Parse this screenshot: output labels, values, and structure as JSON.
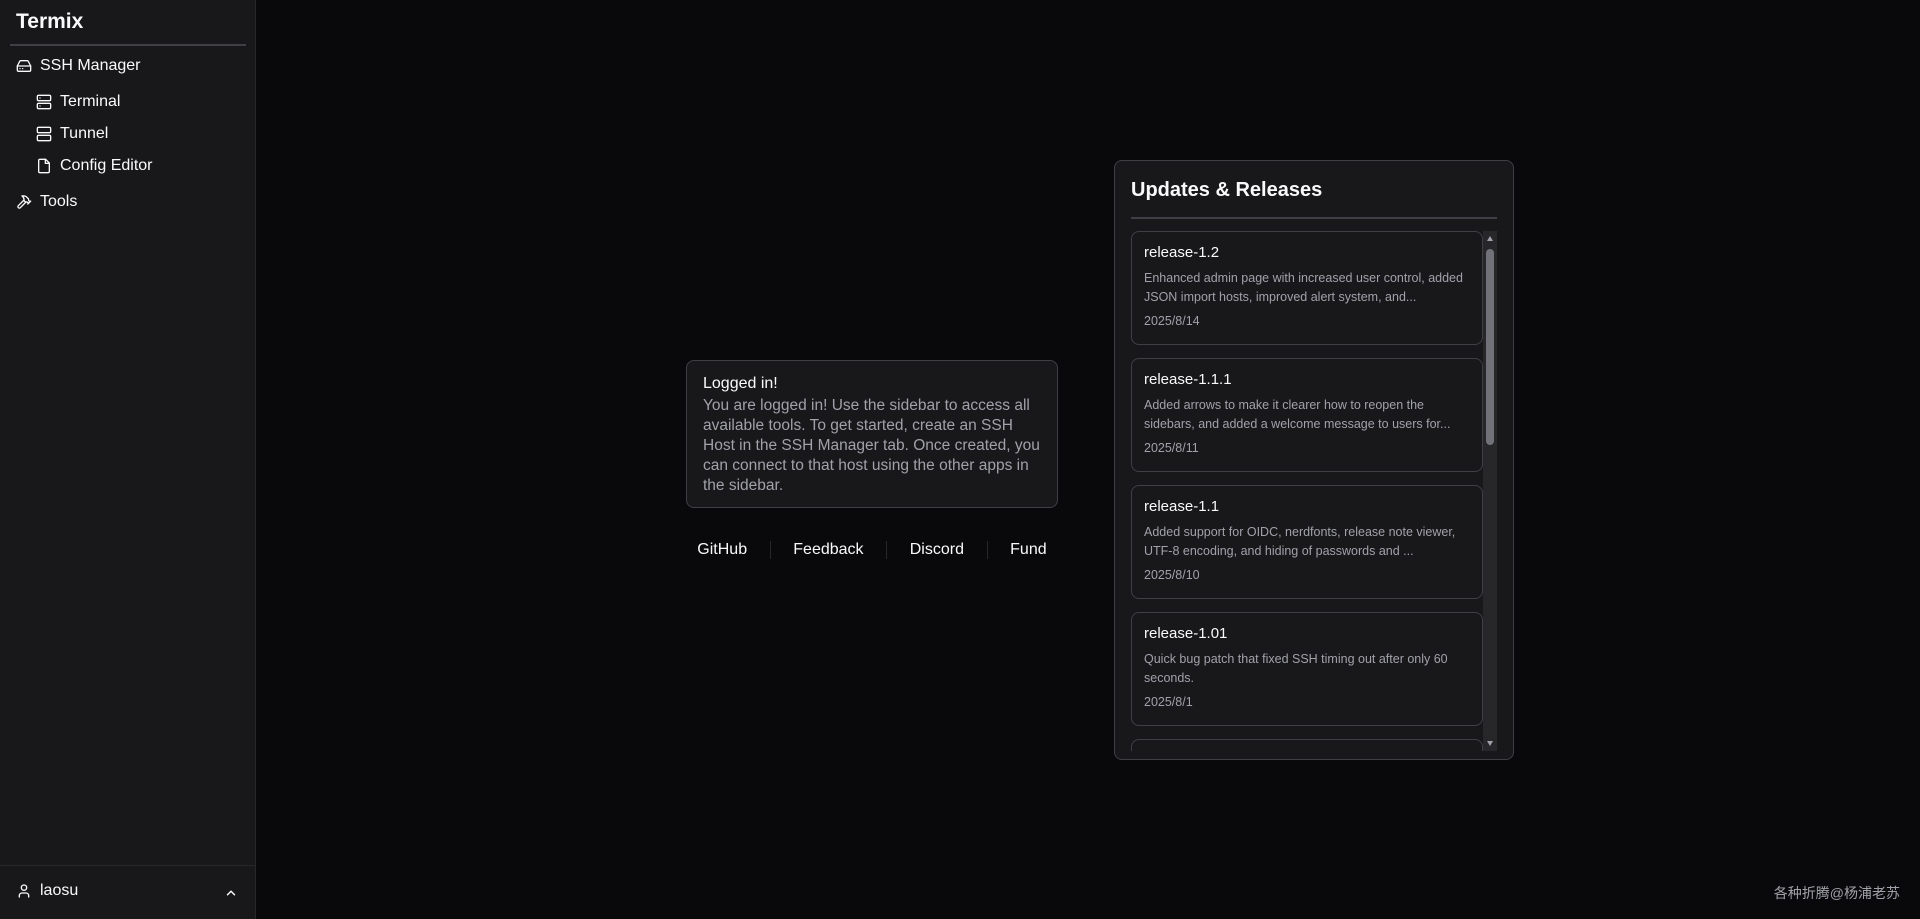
{
  "sidebar": {
    "brand": "Termix",
    "items": [
      {
        "label": "SSH Manager",
        "icon": "hard-drive-icon"
      },
      {
        "label": "Terminal",
        "icon": "server-icon"
      },
      {
        "label": "Tunnel",
        "icon": "server-icon"
      },
      {
        "label": "Config Editor",
        "icon": "file-icon"
      },
      {
        "label": "Tools",
        "icon": "hammer-icon"
      }
    ],
    "user": {
      "name": "laosu",
      "icon": "user-icon",
      "toggle_icon": "chevron-up-icon"
    }
  },
  "login_card": {
    "title": "Logged in!",
    "body": "You are logged in! Use the sidebar to access all available tools. To get started, create an SSH Host in the SSH Manager tab. Once created, you can connect to that host using the other apps in the sidebar."
  },
  "links": [
    "GitHub",
    "Feedback",
    "Discord",
    "Fund"
  ],
  "updates": {
    "title": "Updates & Releases",
    "releases": [
      {
        "name": "release-1.2",
        "desc": "Enhanced admin page with increased user control, added JSON import hosts, improved alert system, and...",
        "date": "2025/8/14"
      },
      {
        "name": "release-1.1.1",
        "desc": "Added arrows to make it clearer how to reopen the sidebars, and added a welcome message to users for...",
        "date": "2025/8/11"
      },
      {
        "name": "release-1.1",
        "desc": "Added support for OIDC, nerdfonts, release note viewer, UTF-8 encoding, and hiding of passwords and ...",
        "date": "2025/8/10"
      },
      {
        "name": "release-1.01",
        "desc": "Quick bug patch that fixed SSH timing out after only 60 seconds.",
        "date": "2025/8/1"
      }
    ]
  },
  "watermark": "各种折腾@杨浦老苏",
  "colors": {
    "background": "#09090b",
    "panel": "#18181b",
    "border": "#3f3f46",
    "muted_text": "#a1a1aa"
  }
}
